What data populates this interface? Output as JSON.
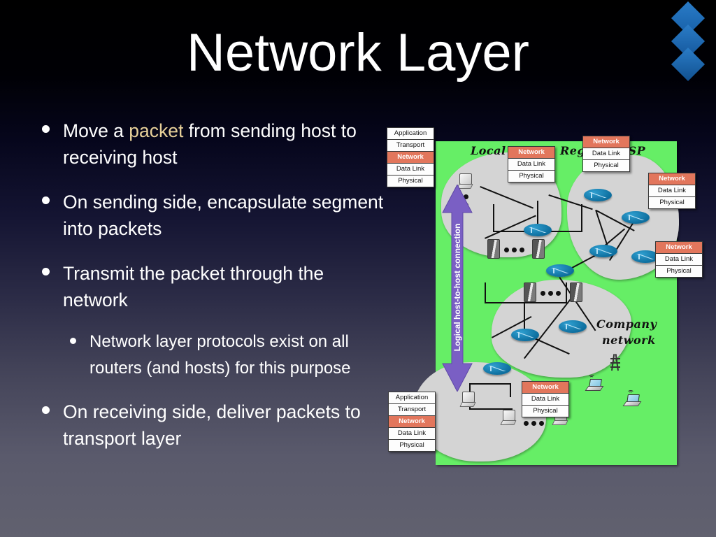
{
  "slide": {
    "title": "Network Layer",
    "background_top_color": "#000000",
    "background_bottom_color": "#61616f",
    "accent_color": "#1f6fb8",
    "highlight_color": "#e8d19a"
  },
  "decoration": {
    "diamonds_count": 3,
    "diamond_color": "#1f6fb8"
  },
  "bullets": [
    {
      "level": 1,
      "text_before": "Move a ",
      "highlight": "packet",
      "text_after": " from sending host to receiving host"
    },
    {
      "level": 1,
      "text": "On sending side, encapsulate segment into packets"
    },
    {
      "level": 1,
      "text": "Transmit the packet through the network"
    },
    {
      "level": 2,
      "text": "Network layer protocols exist on all routers (and hosts) for this purpose"
    },
    {
      "level": 1,
      "text": "On receiving side, deliver packets to transport layer"
    }
  ],
  "diagram": {
    "panel_color": "#66ee66",
    "cloud_color": "#d4d4d4",
    "arrow_label": "Logical host-to-host connection",
    "arrow_color": "#7a5fc4",
    "region_labels": [
      {
        "name": "local-isp-label",
        "text": "Local ISP"
      },
      {
        "name": "regional-isp-label",
        "text": "Regional ISP"
      },
      {
        "name": "company-network-label-line1",
        "text": "Company"
      },
      {
        "name": "company-network-label-line2",
        "text": "network"
      }
    ],
    "full_stack_layers": [
      "Application",
      "Transport",
      "Network",
      "Data Link",
      "Physical"
    ],
    "router_stack_layers": [
      "Network",
      "Data Link",
      "Physical"
    ],
    "highlighted_layer": "Network",
    "highlight_bg": "#e2765c",
    "stacks": [
      {
        "name": "sending-host-stack",
        "type": "full"
      },
      {
        "name": "local-isp-router-stack",
        "type": "router"
      },
      {
        "name": "regional-isp-router-stack-1",
        "type": "router"
      },
      {
        "name": "regional-isp-router-stack-2",
        "type": "router"
      },
      {
        "name": "company-edge-router-stack",
        "type": "router"
      },
      {
        "name": "company-network-router-stack",
        "type": "router"
      },
      {
        "name": "receiving-host-stack",
        "type": "full"
      }
    ]
  }
}
